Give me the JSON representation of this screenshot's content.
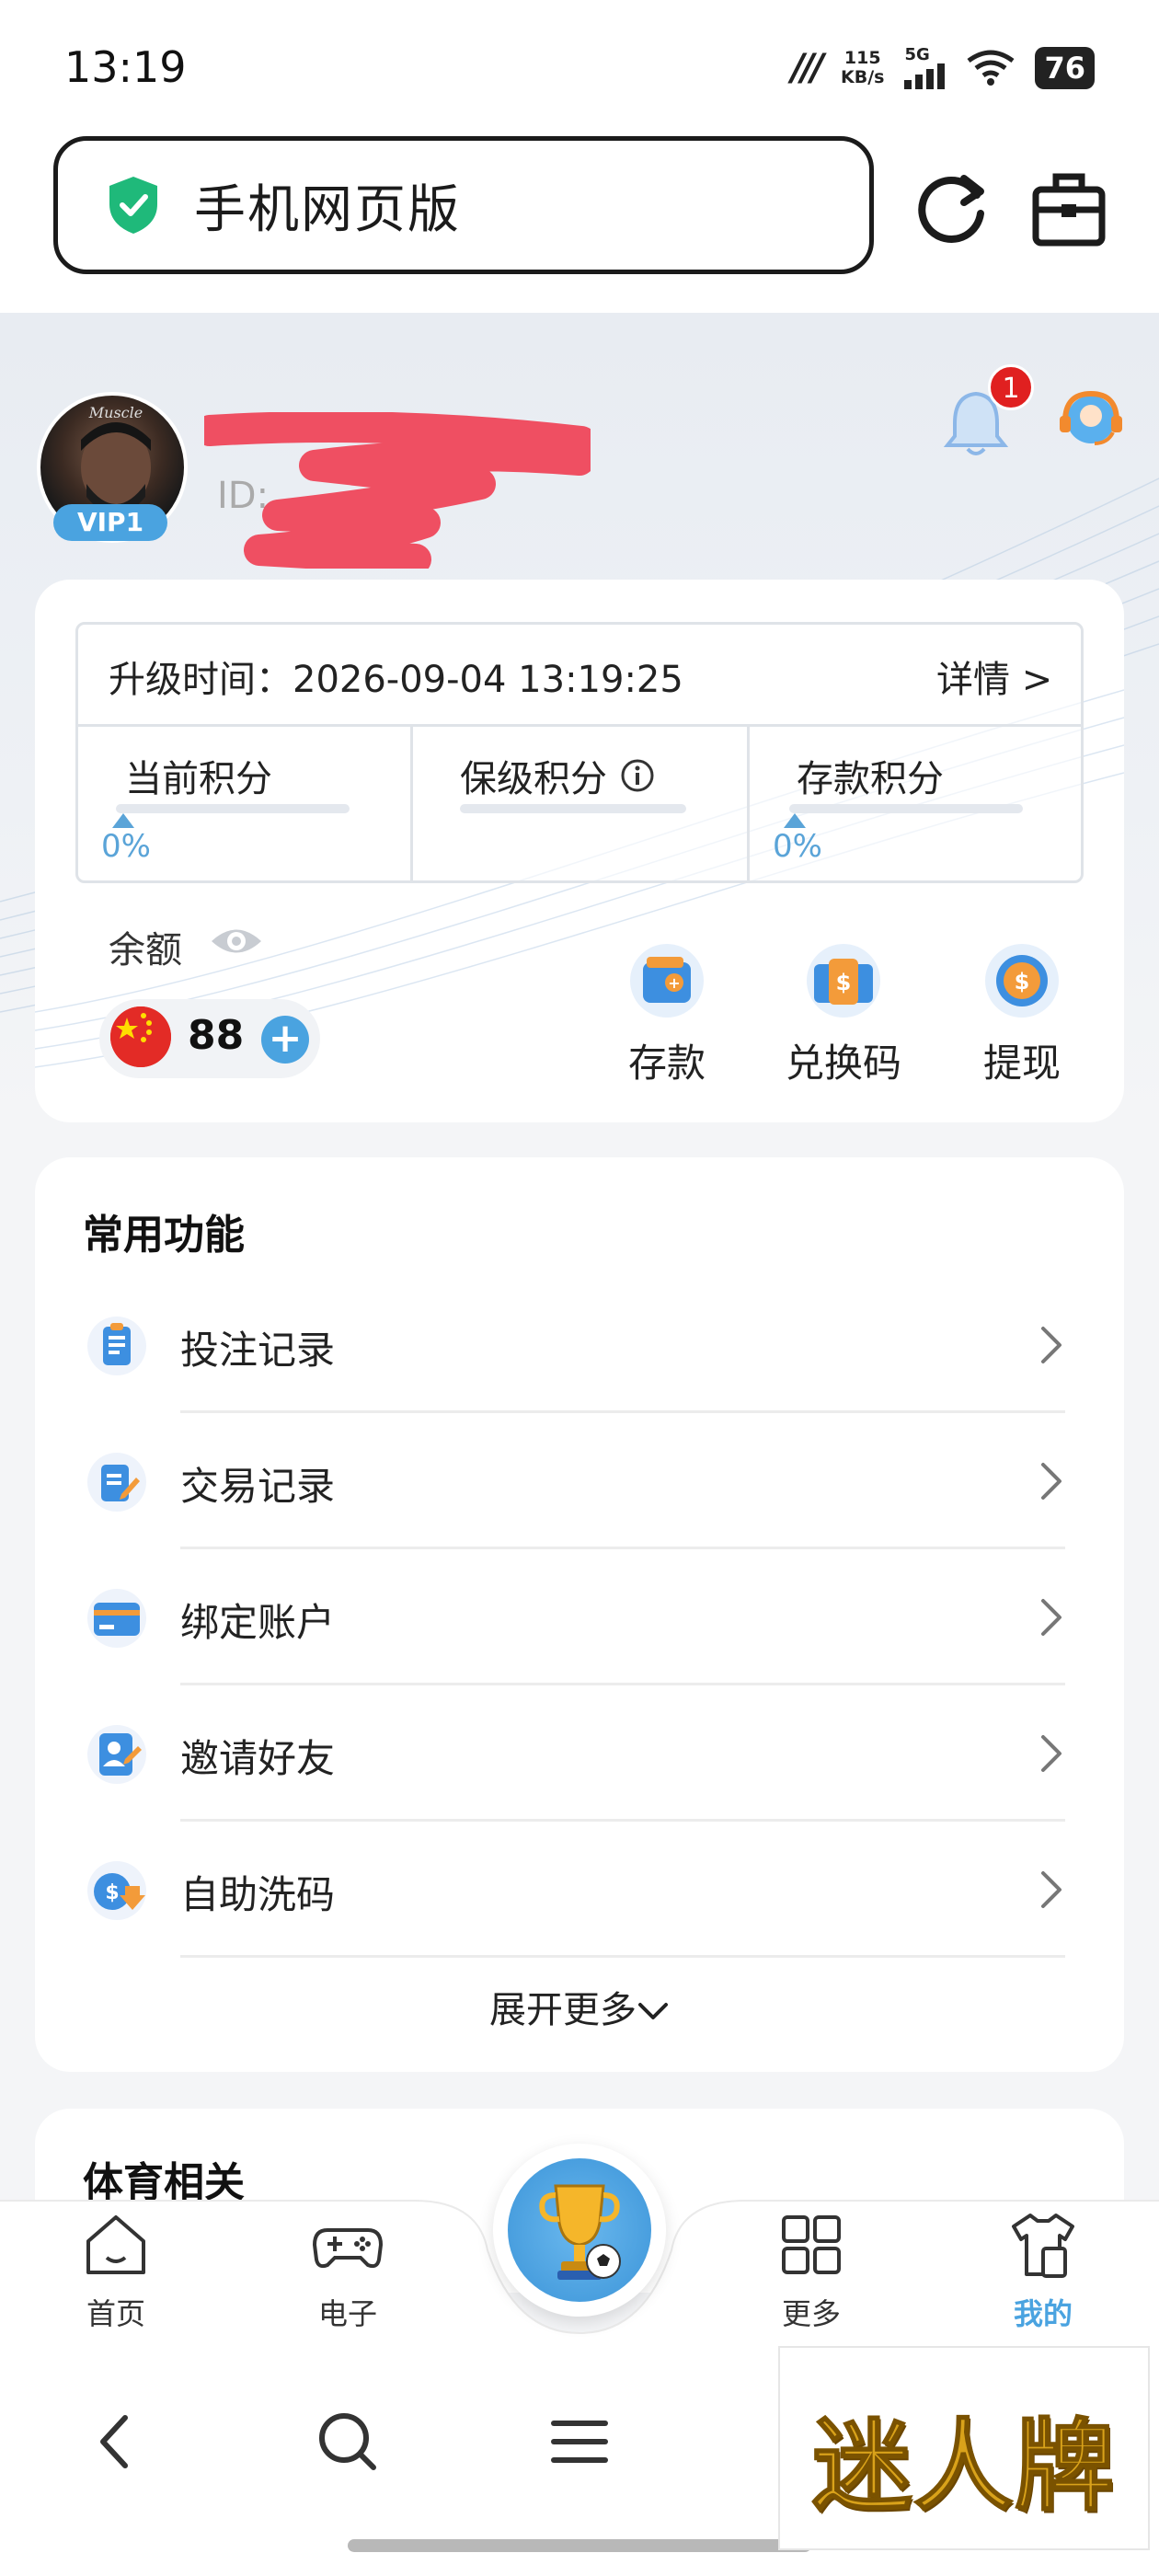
{
  "status": {
    "time": "13:19",
    "net_speed_value": "115",
    "net_speed_unit": "KB/s",
    "network": "5G",
    "battery": "76"
  },
  "browser": {
    "url_title": "手机网页版"
  },
  "profile": {
    "username": "",
    "id_label": "ID:",
    "vip_level": "VIP1",
    "notification_count": "1"
  },
  "vip_card": {
    "upgrade_label": "升级时间：2026-09-04 13:19:25",
    "details_label": "详情 >",
    "current_points_label": "当前积分",
    "current_points_pct": "0%",
    "keep_points_label": "保级积分",
    "deposit_points_label": "存款积分",
    "deposit_points_pct": "0%"
  },
  "balance": {
    "label": "余额",
    "value": "88"
  },
  "actions": {
    "deposit": "存款",
    "redeem": "兑换码",
    "withdraw": "提现"
  },
  "common": {
    "title": "常用功能",
    "items": [
      "投注记录",
      "交易记录",
      "绑定账户",
      "邀请好友",
      "自助洗码"
    ],
    "expand": "展开更多"
  },
  "sports": {
    "title": "体育相关"
  },
  "tabs": {
    "home": "首页",
    "electronic": "电子",
    "more": "更多",
    "mine": "我的"
  },
  "colors": {
    "accent": "#4aa3e0",
    "badge": "#e02020",
    "active_tab": "#4aa3e0"
  },
  "watermark": {
    "text": "迷人牌"
  }
}
